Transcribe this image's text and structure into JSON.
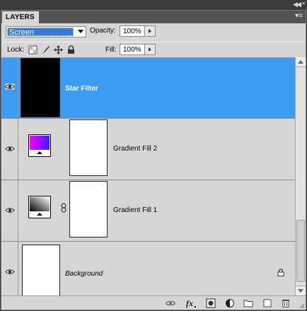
{
  "panel": {
    "tab_title": "LAYERS",
    "blend_mode": "Screen",
    "opacity_label": "Opacity:",
    "opacity_value": "100%",
    "lock_label": "Lock:",
    "fill_label": "Fill:",
    "fill_value": "100%"
  },
  "layers": [
    {
      "name": "Star Filter",
      "selected": true,
      "visible": true,
      "italic": false
    },
    {
      "name": "Gradient Fill 2",
      "selected": false,
      "visible": true,
      "italic": false
    },
    {
      "name": "Gradient Fill 1",
      "selected": false,
      "visible": true,
      "italic": false
    },
    {
      "name": "Background",
      "selected": false,
      "visible": true,
      "italic": true
    }
  ],
  "colors": {
    "selection": "#3d9cf2",
    "panel_bg": "#d6d6d6",
    "gradient2_from": "#ff00ff",
    "gradient2_to": "#3a1cff"
  },
  "footer_icons": [
    "link-icon",
    "fx-icon",
    "mask-icon",
    "adjustment-icon",
    "folder-icon",
    "new-layer-icon",
    "trash-icon"
  ]
}
